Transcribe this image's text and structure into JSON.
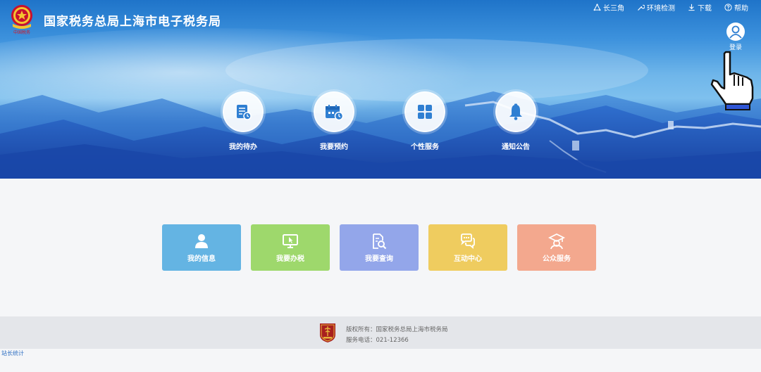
{
  "header": {
    "site_title": "国家税务总局上海市电子税务局",
    "emblem_text": "中国税务"
  },
  "top_links": [
    {
      "label": "长三角",
      "icon": "triangle-network-icon"
    },
    {
      "label": "环境检测",
      "icon": "wrench-icon"
    },
    {
      "label": "下载",
      "icon": "download-icon"
    },
    {
      "label": "帮助",
      "icon": "help-circle-icon"
    }
  ],
  "login": {
    "label": "登录",
    "icon": "user-avatar-icon"
  },
  "quick_menu": [
    {
      "label": "我的待办",
      "icon": "todo-document-icon"
    },
    {
      "label": "我要预约",
      "icon": "calendar-clock-icon"
    },
    {
      "label": "个性服务",
      "icon": "grid-squares-icon"
    },
    {
      "label": "通知公告",
      "icon": "bell-icon"
    }
  ],
  "tiles": [
    {
      "label": "我的信息",
      "icon": "person-icon",
      "color": "#64b4e3"
    },
    {
      "label": "我要办税",
      "icon": "monitor-cursor-icon",
      "color": "#9ed86c"
    },
    {
      "label": "我要查询",
      "icon": "document-search-icon",
      "color": "#93a6ea"
    },
    {
      "label": "互动中心",
      "icon": "chat-bubbles-icon",
      "color": "#efcc5f"
    },
    {
      "label": "公众服务",
      "icon": "graduate-icon",
      "color": "#f3a88e"
    }
  ],
  "footer": {
    "copyright": "版权所有：国家税务总局上海市税务局",
    "phone": "服务电话：021-12366"
  },
  "stats_link": "站长统计",
  "colors": {
    "banner_top": "#1f74c9",
    "footer_bg": "#e4e6ea",
    "icon_blue": "#2f7fd2"
  }
}
